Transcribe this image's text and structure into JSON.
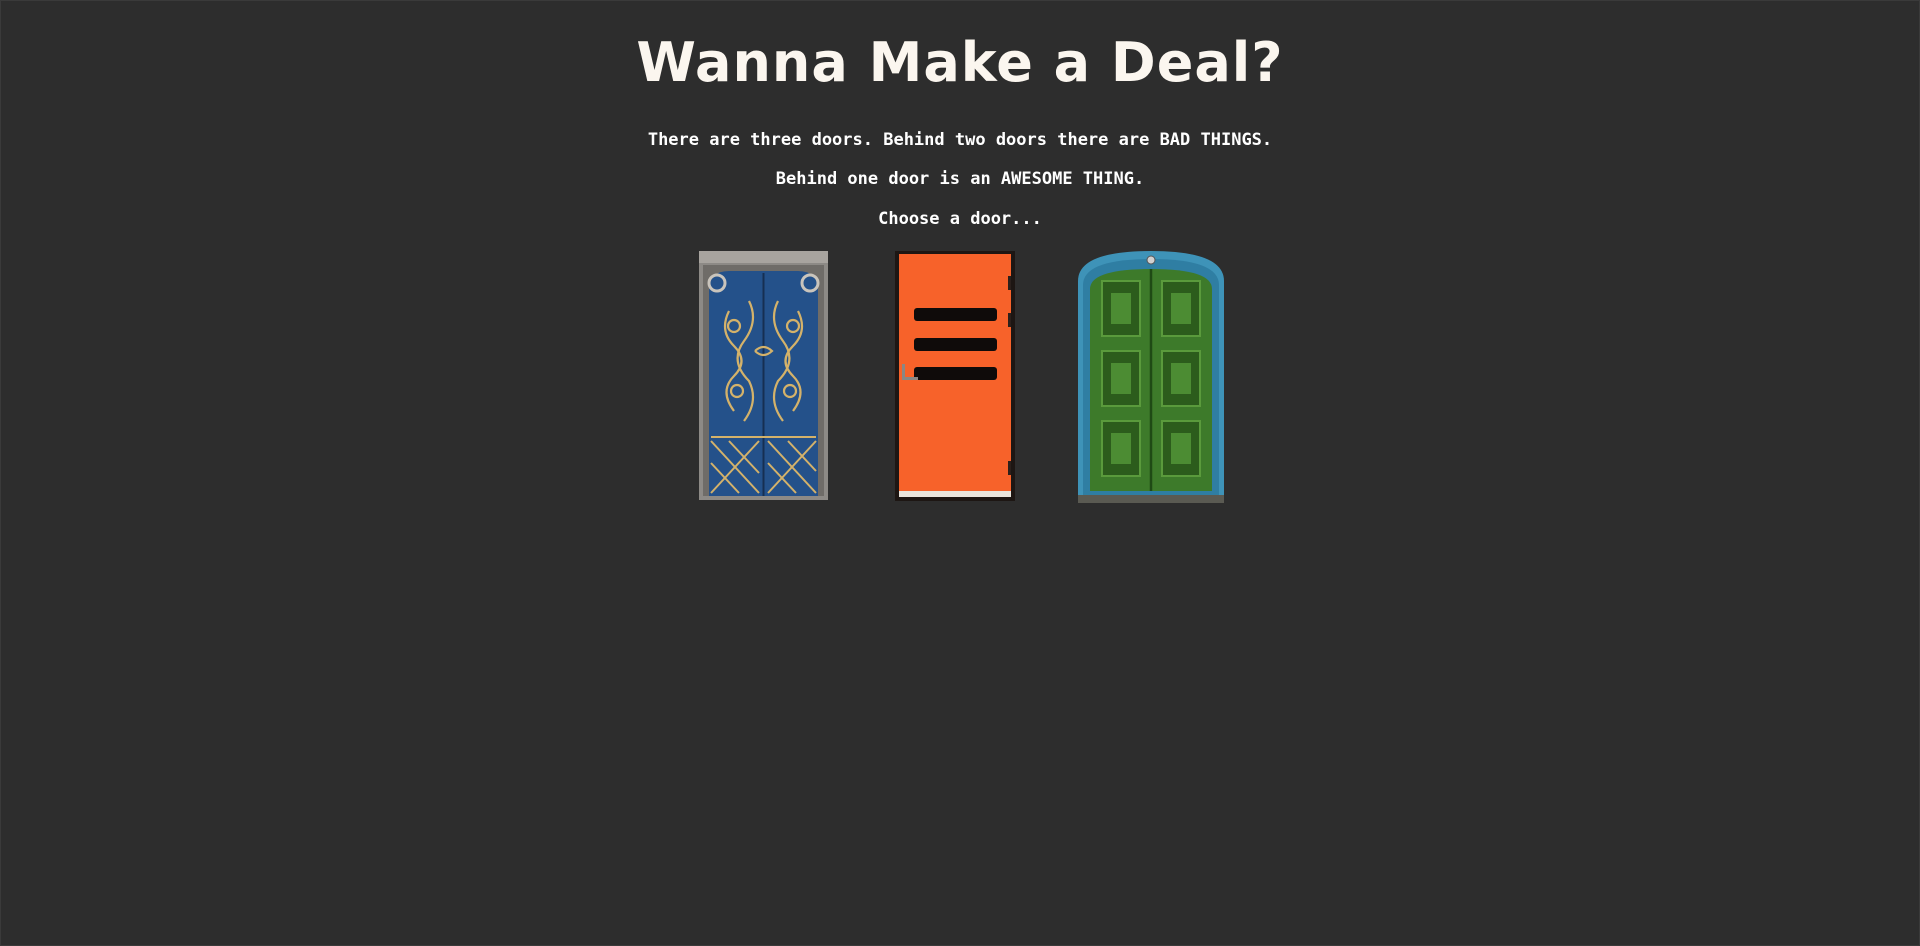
{
  "page": {
    "title": "Wanna Make a Deal?",
    "intro_lines": [
      "There are three doors. Behind two doors there are BAD THINGS.",
      "Behind one door is an AWESOME THING.",
      "Choose a door..."
    ]
  },
  "doors": [
    {
      "name": "ornate-blue-door",
      "color": "#2a5a8a"
    },
    {
      "name": "orange-door",
      "color": "#f7622a"
    },
    {
      "name": "green-door",
      "color": "#3d7a2a"
    }
  ],
  "colors": {
    "background": "#2d2d2d",
    "title": "#fbf6ef",
    "text": "#ffffff"
  }
}
